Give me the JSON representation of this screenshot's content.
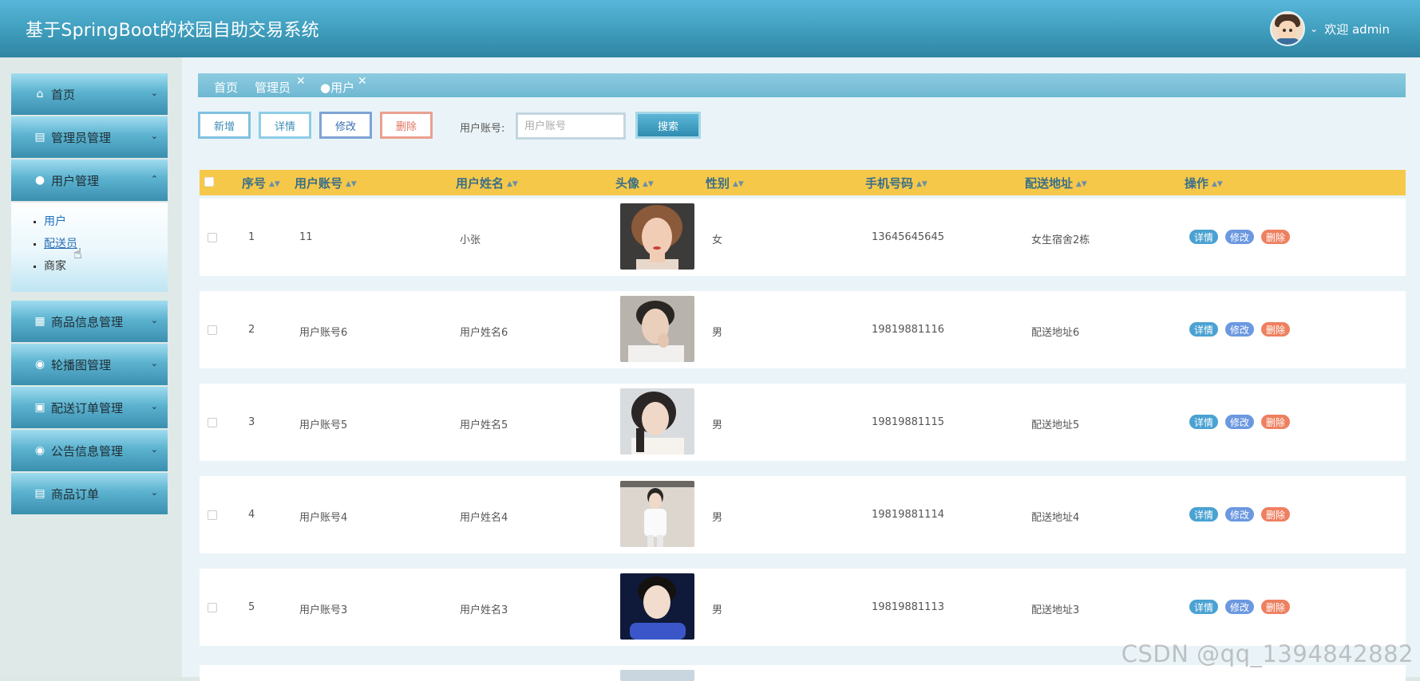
{
  "header": {
    "title": "基于SpringBoot的校园自助交易系统",
    "welcome": "欢迎 admin"
  },
  "sidebar": {
    "items": [
      {
        "label": "首页",
        "icon": "home-icon"
      },
      {
        "label": "管理员管理",
        "icon": "admin-icon"
      },
      {
        "label": "用户管理",
        "icon": "user-icon",
        "expanded": true
      },
      {
        "label": "商品信息管理",
        "icon": "goods-icon"
      },
      {
        "label": "轮播图管理",
        "icon": "carousel-icon"
      },
      {
        "label": "配送订单管理",
        "icon": "delivery-icon"
      },
      {
        "label": "公告信息管理",
        "icon": "notice-icon"
      },
      {
        "label": "商品订单",
        "icon": "order-icon"
      }
    ],
    "submenu": [
      {
        "label": "用户"
      },
      {
        "label": "配送员"
      },
      {
        "label": "商家"
      }
    ]
  },
  "tabs": [
    {
      "label": "首页"
    },
    {
      "label": "管理员"
    },
    {
      "label": "●用户"
    }
  ],
  "toolbar": {
    "add": "新增",
    "detail": "详情",
    "edit": "修改",
    "delete": "删除",
    "search_label": "用户账号:",
    "search_placeholder": "用户账号",
    "search_button": "搜索"
  },
  "table": {
    "columns": [
      "序号",
      "用户账号",
      "用户姓名",
      "头像",
      "性别",
      "手机号码",
      "配送地址",
      "操作"
    ],
    "rows": [
      {
        "index": "1",
        "account": "11",
        "name": "小张",
        "gender": "女",
        "phone": "13645645645",
        "address": "女生宿舍2栋"
      },
      {
        "index": "2",
        "account": "用户账号6",
        "name": "用户姓名6",
        "gender": "男",
        "phone": "19819881116",
        "address": "配送地址6"
      },
      {
        "index": "3",
        "account": "用户账号5",
        "name": "用户姓名5",
        "gender": "男",
        "phone": "19819881115",
        "address": "配送地址5"
      },
      {
        "index": "4",
        "account": "用户账号4",
        "name": "用户姓名4",
        "gender": "男",
        "phone": "19819881114",
        "address": "配送地址4"
      },
      {
        "index": "5",
        "account": "用户账号3",
        "name": "用户姓名3",
        "gender": "男",
        "phone": "19819881113",
        "address": "配送地址3"
      }
    ],
    "row_actions": {
      "detail": "详情",
      "edit": "修改",
      "delete": "删除"
    }
  },
  "watermark": "CSDN @qq_1394842882",
  "colors": {
    "header": "#3d9ab9",
    "table_header": "#f6c84a",
    "detail": "#4aa2d2",
    "edit": "#6b98e0",
    "delete": "#ee8060"
  }
}
